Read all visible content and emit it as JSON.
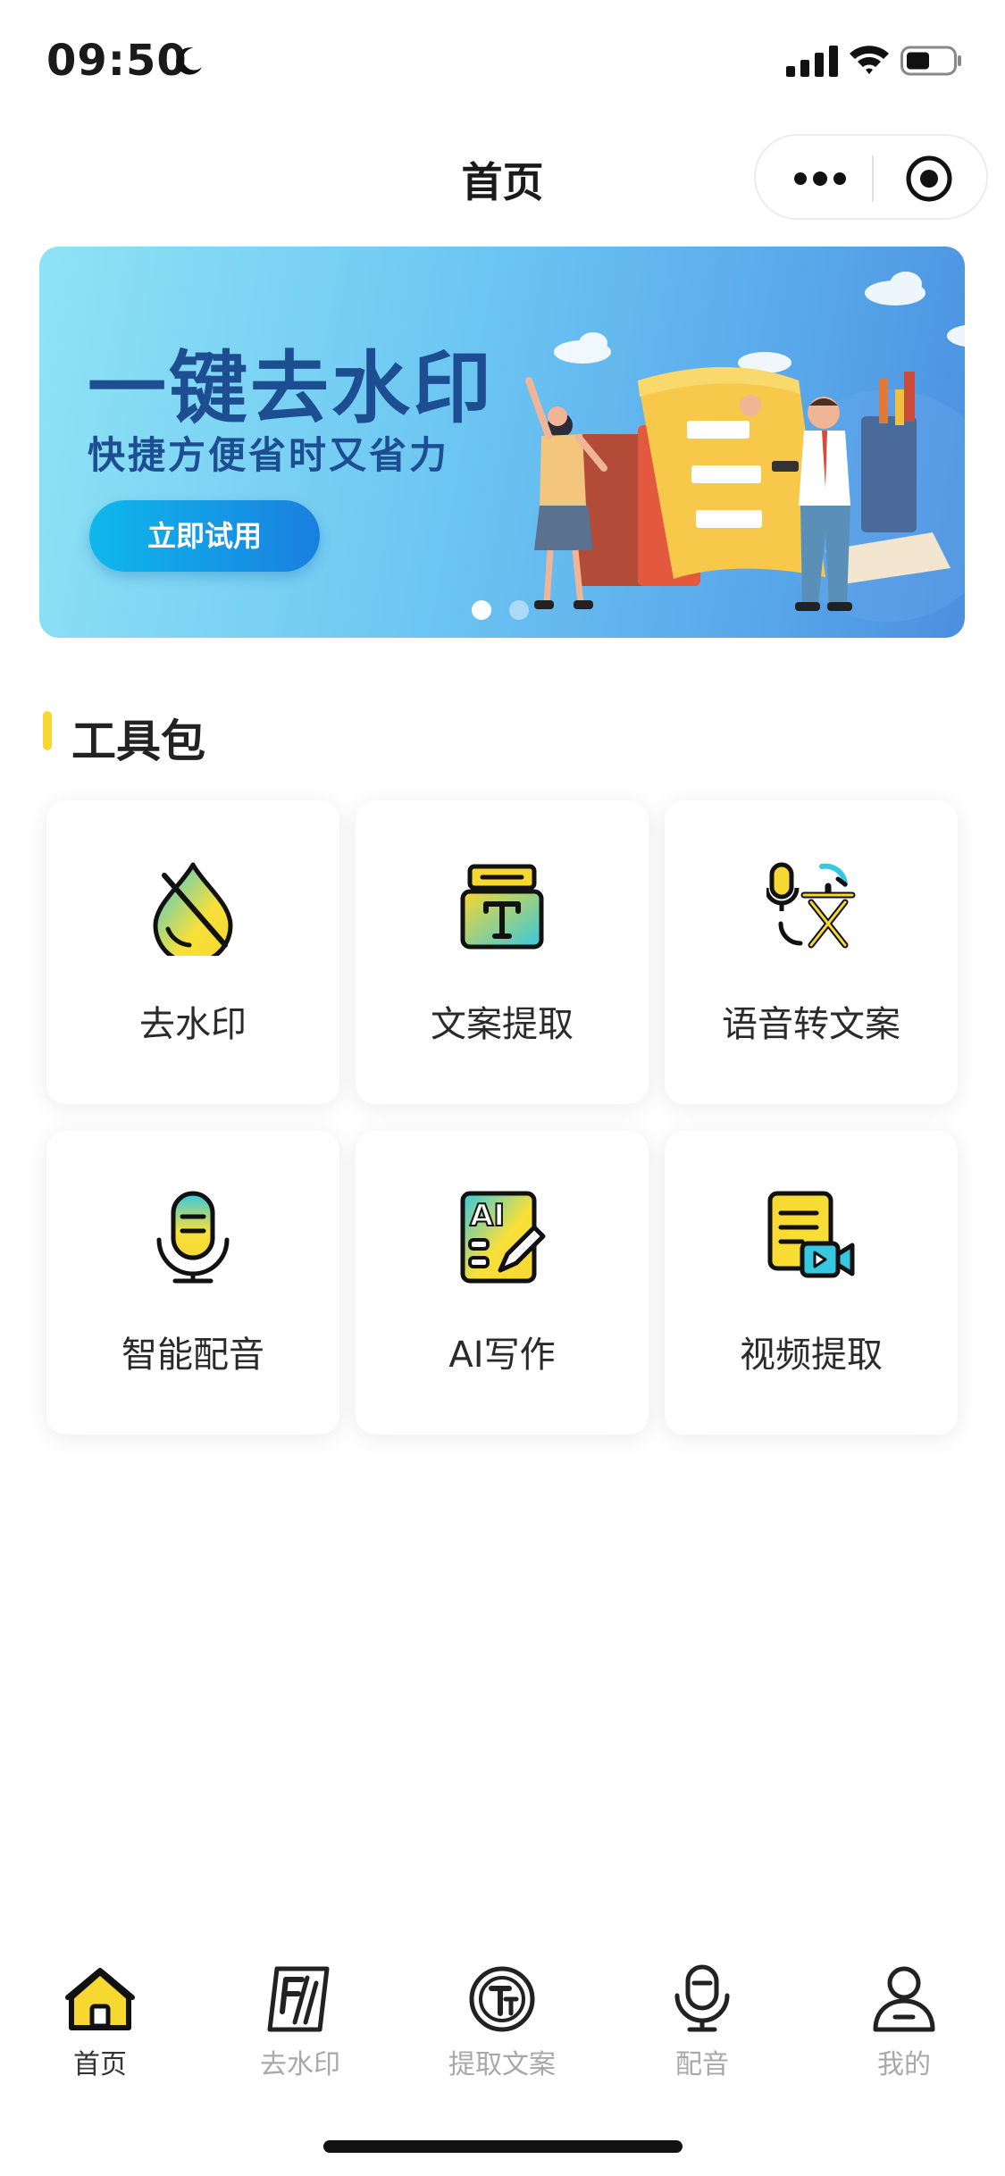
{
  "status_bar": {
    "time": "09:50"
  },
  "nav": {
    "title": "首页"
  },
  "banner": {
    "title": "一键去水印",
    "subtitle": "快捷方便省时又省力",
    "button_label": "立即试用",
    "page_count": 2,
    "active_page": 1
  },
  "section": {
    "title": "工具包"
  },
  "tools": [
    {
      "label": "去水印",
      "icon": "watermark-remove-icon"
    },
    {
      "label": "文案提取",
      "icon": "text-extract-icon"
    },
    {
      "label": "语音转文案",
      "icon": "speech-to-text-icon"
    },
    {
      "label": "智能配音",
      "icon": "microphone-icon"
    },
    {
      "label": "AI写作",
      "icon": "ai-writing-icon"
    },
    {
      "label": "视频提取",
      "icon": "video-extract-icon"
    }
  ],
  "tabbar": [
    {
      "label": "首页",
      "icon": "home-icon",
      "active": true
    },
    {
      "label": "去水印",
      "icon": "watermark-icon",
      "active": false
    },
    {
      "label": "提取文案",
      "icon": "text-icon",
      "active": false
    },
    {
      "label": "配音",
      "icon": "mic-icon",
      "active": false
    },
    {
      "label": "我的",
      "icon": "user-icon",
      "active": false
    }
  ],
  "colors": {
    "accent": "#f7d830",
    "banner_text": "#1d4e92",
    "tab_active": "#333333",
    "tab_inactive": "#a8a8a8"
  }
}
